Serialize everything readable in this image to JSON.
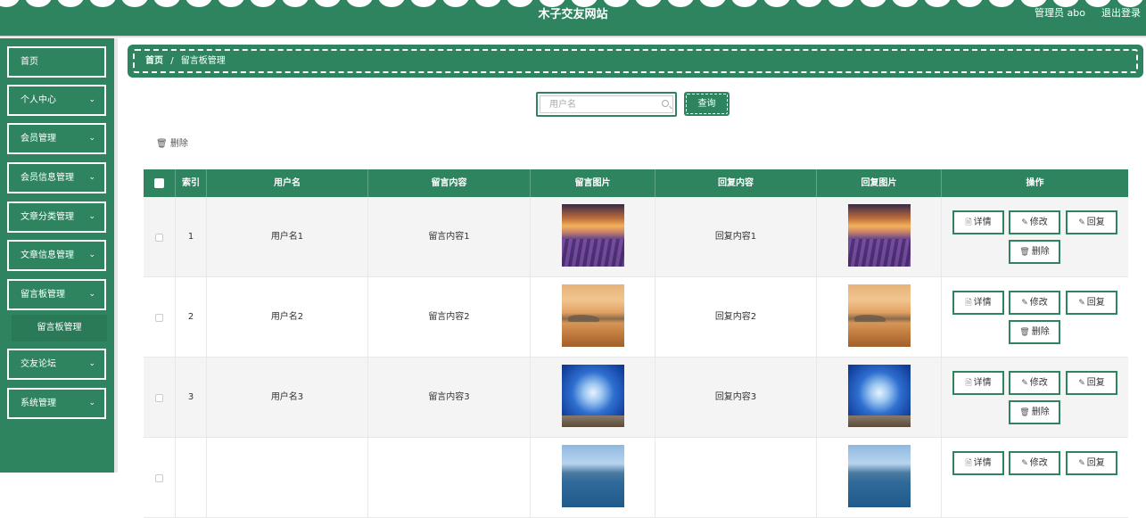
{
  "header": {
    "site_title": "木子交友网站",
    "admin_label": "管理员 abo",
    "logout_label": "退出登录"
  },
  "sidebar": {
    "items": [
      {
        "label": "首页",
        "has_arrow": false
      },
      {
        "label": "个人中心",
        "has_arrow": true
      },
      {
        "label": "会员管理",
        "has_arrow": true
      },
      {
        "label": "会员信息管理",
        "has_arrow": true
      },
      {
        "label": "文章分类管理",
        "has_arrow": true
      },
      {
        "label": "文章信息管理",
        "has_arrow": true
      },
      {
        "label": "留言板管理",
        "has_arrow": true
      },
      {
        "label": "交友论坛",
        "has_arrow": true
      },
      {
        "label": "系统管理",
        "has_arrow": true
      }
    ],
    "sub_item": "留言板管理",
    "arrow_icon": "chevron-down-icon"
  },
  "breadcrumb": {
    "home": "首页",
    "separator": "/",
    "current": "留言板管理"
  },
  "search": {
    "placeholder": "用户名",
    "value": "",
    "query_label": "查询"
  },
  "toolbar": {
    "delete_label": "删除"
  },
  "table": {
    "columns": [
      "索引",
      "用户名",
      "留言内容",
      "留言图片",
      "回复内容",
      "回复图片",
      "操作"
    ],
    "rows": [
      {
        "index": "1",
        "username": "用户名1",
        "message": "留言内容1",
        "reply": "回复内容1",
        "image": "lavender-field-sunset"
      },
      {
        "index": "2",
        "username": "用户名2",
        "message": "留言内容2",
        "reply": "回复内容2",
        "image": "misty-sunset"
      },
      {
        "index": "3",
        "username": "用户名3",
        "message": "留言内容3",
        "reply": "回复内容3",
        "image": "blue-sky-person"
      },
      {
        "index": "",
        "username": "",
        "message": "",
        "reply": "",
        "image": "mountain-lake"
      }
    ],
    "actions": {
      "detail": "详情",
      "edit": "修改",
      "reply": "回复",
      "delete": "删除"
    }
  },
  "colors": {
    "primary": "#2f8460",
    "white": "#ffffff",
    "row_stripe": "#f4f4f4"
  }
}
